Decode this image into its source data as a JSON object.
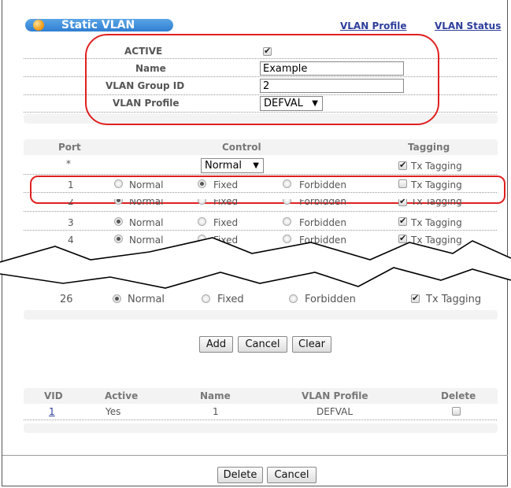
{
  "header": {
    "title": "Static VLAN",
    "links": [
      "VLAN Profile",
      "VLAN Status"
    ]
  },
  "form": {
    "active_label": "ACTIVE",
    "active_checked": true,
    "name_label": "Name",
    "name_value": "Example",
    "group_id_label": "VLAN Group ID",
    "group_id_value": "2",
    "profile_label": "VLAN Profile",
    "profile_value": "DEFVAL"
  },
  "ports": {
    "headers": {
      "port": "Port",
      "control": "Control",
      "tagging": "Tagging"
    },
    "all_row": {
      "port": "*",
      "control_value": "Normal",
      "tagging_label": "Tx Tagging",
      "tagged": true
    },
    "option_labels": {
      "normal": "Normal",
      "fixed": "Fixed",
      "forbidden": "Forbidden",
      "tagging": "Tx Tagging"
    },
    "rows": [
      {
        "port": "1",
        "control": "fixed",
        "tagged": false
      },
      {
        "port": "2",
        "control": "normal",
        "tagged": true
      },
      {
        "port": "3",
        "control": "normal",
        "tagged": true
      },
      {
        "port": "4",
        "control": "normal",
        "tagged": true
      },
      {
        "port": "26",
        "control": "normal",
        "tagged": true
      }
    ]
  },
  "buttons": {
    "add": "Add",
    "cancel": "Cancel",
    "clear": "Clear",
    "delete": "Delete",
    "cancel2": "Cancel"
  },
  "summary": {
    "headers": [
      "VID",
      "Active",
      "Name",
      "VLAN Profile",
      "Delete"
    ],
    "rows": [
      {
        "vid": "1",
        "active": "Yes",
        "name": "1",
        "profile": "DEFVAL",
        "delete": false
      }
    ]
  },
  "annotation_color": "#e02020"
}
